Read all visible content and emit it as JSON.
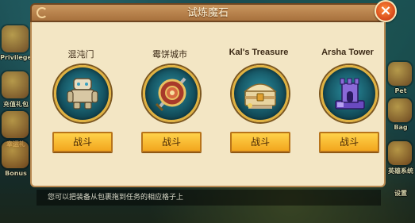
{
  "dialog": {
    "title": "试炼魔石",
    "close_label": "×"
  },
  "missions": [
    {
      "name": "混沌门",
      "button": "战斗",
      "icon": "stone-golem-icon"
    },
    {
      "name": "霉饼城市",
      "button": "战斗",
      "icon": "shield-sword-icon"
    },
    {
      "name": "Kal's Treasure",
      "button": "战斗",
      "icon": "treasure-chest-icon"
    },
    {
      "name": "Arsha Tower",
      "button": "战斗",
      "icon": "purple-tower-icon"
    }
  ],
  "background": {
    "left_labels": [
      "Privilege",
      "充值礼包",
      "幸运礼",
      "Bonus"
    ],
    "right_labels": [
      "Pet",
      "Bag",
      "英雄系统",
      "设置"
    ],
    "hint": "您可以把装备从包裹拖到任务的相应格子上"
  },
  "colors": {
    "title_bar": "#b98a52",
    "panel": "#f3e6c4",
    "button": "#f2a61e",
    "medallion": "#14505e",
    "close": "#d6471a"
  }
}
